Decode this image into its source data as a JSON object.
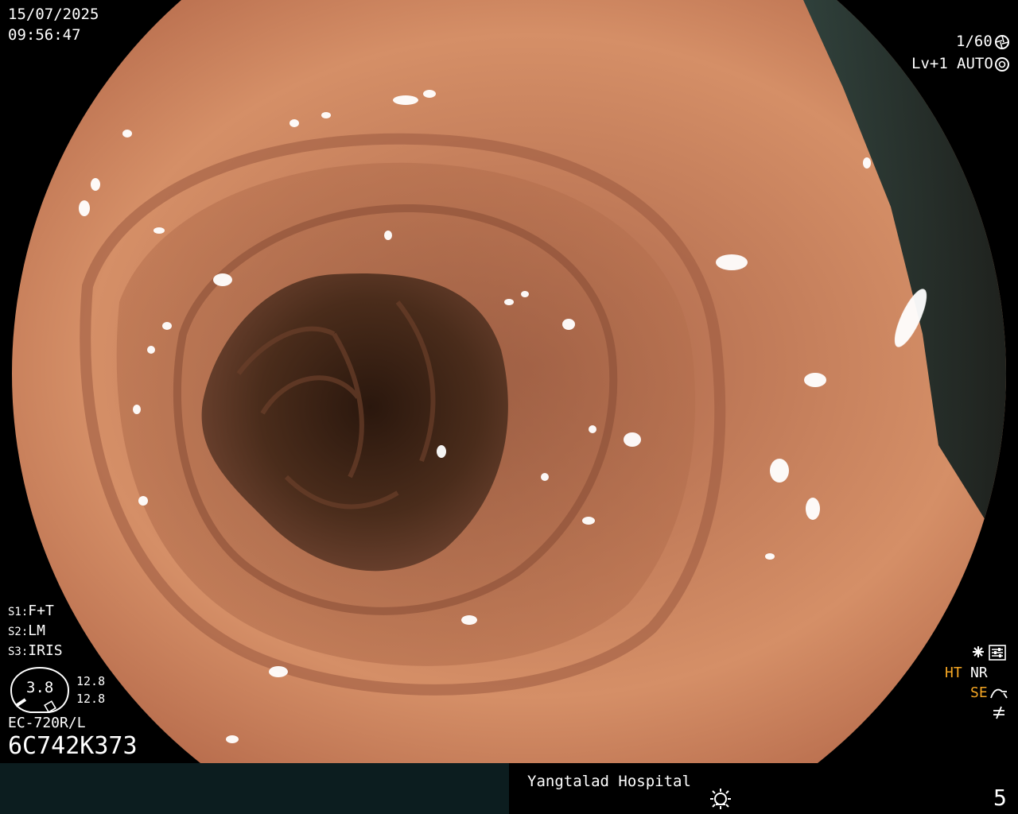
{
  "overlay": {
    "date": "15/07/2025",
    "time": "09:56:47",
    "shutter": "1/60",
    "level": "Lv+1",
    "iris_mode": "AUTO",
    "s1": "F+T",
    "s2": "LM",
    "s3": "IRIS",
    "s1_label": "S1:",
    "s2_label": "S2:",
    "s3_label": "S3:",
    "gauge_value": "3.8",
    "gauge_top": "12.8",
    "gauge_bottom": "12.8",
    "scope_model": "EC-720R/L",
    "serial": "6C742K373",
    "ht": "HT",
    "nr": "NR",
    "se": "SE"
  },
  "footer": {
    "hospital": "Yangtalad Hospital",
    "image_number": "5"
  },
  "icons": [
    "shutter-icon",
    "iris-icon",
    "settings-icon",
    "curve-icon",
    "not-equal-icon",
    "brightness-icon"
  ],
  "colors": {
    "mucosa": "#c9825f",
    "lumen": "#3a2416",
    "highlight_text": "#f5a623",
    "footer_bg": "#0c1d1f"
  }
}
